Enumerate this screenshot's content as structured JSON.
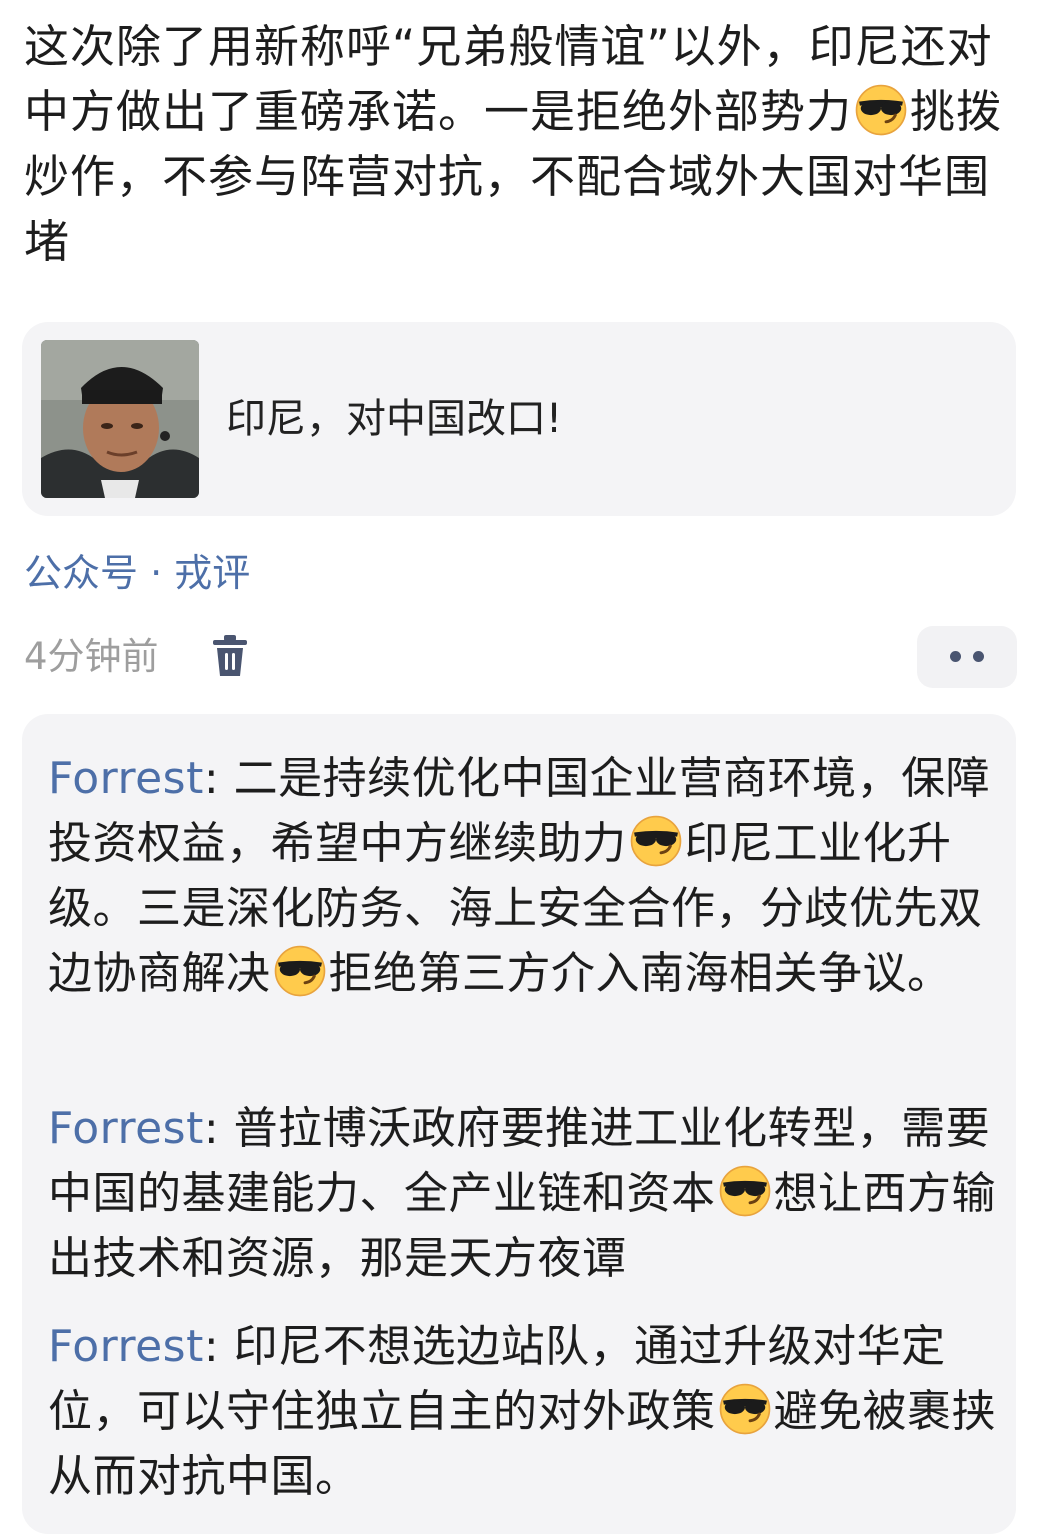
{
  "post": {
    "text_part1": "这次除了用新称呼“兄弟般情谊”以外，印尼还对中方做出了重磅承诺。一是拒绝外部势力",
    "emoji_name": "smiling-face-with-sunglasses",
    "text_part2": "挑拨炒作，不参与阵营对抗，不配合域外大国对华围堵"
  },
  "share_card": {
    "title": "印尼，对中国改口!"
  },
  "source": {
    "label": "公众号 · 戎评"
  },
  "meta": {
    "time": "4分钟前"
  },
  "comments": [
    {
      "author": "Forrest",
      "separator": ": ",
      "text_part1": "二是持续优化中国企业营商环境，保障投资权益，希望中方继续助力",
      "text_part2": "印尼工业化升级。三是深化防务、海上安全合作，分歧优先双边协商解决",
      "text_part3": "拒绝第三方介入南海相关争议。"
    },
    {
      "author": "Forrest",
      "separator": ": ",
      "text_part1": "普拉博沃政府要推进工业化转型，需要中国的基建能力、全产业链和资本",
      "text_part2": "想让西方输出技术和资源，那是天方夜谭"
    },
    {
      "author": "Forrest",
      "separator": ": ",
      "text_part1": "印尼不想选边站队，通过升级对华定位，可以守住独立自主的对外政策",
      "text_part2": "避免被裹挟从而对抗中国。"
    }
  ],
  "colors": {
    "link_blue": "#4d6fa8",
    "card_bg": "#f4f4f6",
    "meta_gray": "#9e9e9e"
  }
}
